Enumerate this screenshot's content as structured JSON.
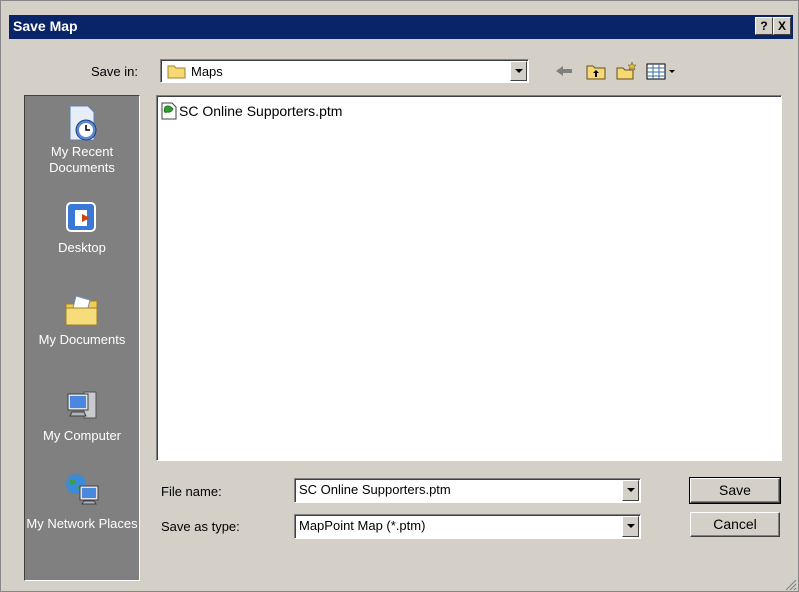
{
  "window": {
    "title": "Save Map",
    "help_label": "?",
    "close_label": "X"
  },
  "toolbar": {
    "save_in_label": "Save in:",
    "save_in_value": "Maps",
    "icons": [
      "back-icon",
      "up-folder-icon",
      "new-folder-icon",
      "view-menu-icon"
    ]
  },
  "places": [
    {
      "name": "recent",
      "label": "My Recent Documents",
      "icon": "recent-documents-icon"
    },
    {
      "name": "desktop",
      "label": "Desktop",
      "icon": "desktop-icon"
    },
    {
      "name": "documents",
      "label": "My Documents",
      "icon": "my-documents-icon"
    },
    {
      "name": "computer",
      "label": "My Computer",
      "icon": "my-computer-icon"
    },
    {
      "name": "network",
      "label": "My Network Places",
      "icon": "network-places-icon"
    }
  ],
  "files": [
    {
      "name": "SC Online Supporters.ptm",
      "icon": "ptm-file-icon"
    }
  ],
  "form": {
    "file_name_label": "File name:",
    "file_name_value": "SC Online Supporters.ptm",
    "save_type_label": "Save as type:",
    "save_type_value": "MapPoint Map (*.ptm)"
  },
  "buttons": {
    "save": "Save",
    "cancel": "Cancel"
  },
  "colors": {
    "titlebar": "#0a246a",
    "dialog": "#d4d0c8",
    "places_bar": "#808080"
  }
}
